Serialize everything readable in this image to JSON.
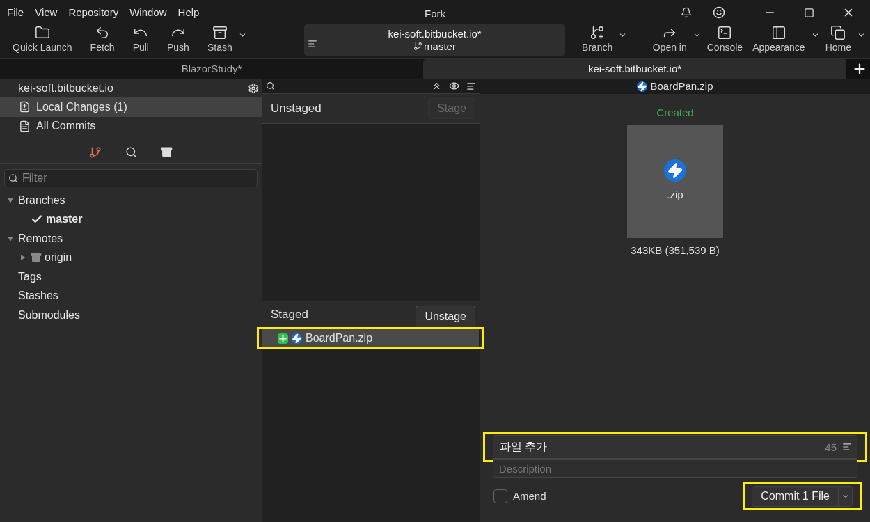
{
  "window": {
    "title": "Fork"
  },
  "menu": [
    {
      "label": "File"
    },
    {
      "label": "View"
    },
    {
      "label": "Repository"
    },
    {
      "label": "Window"
    },
    {
      "label": "Help"
    }
  ],
  "toolbar_left": [
    {
      "label": "Quick Launch",
      "dropdown": false
    },
    {
      "label": "Fetch",
      "dropdown": false
    },
    {
      "label": "Pull",
      "dropdown": false
    },
    {
      "label": "Push",
      "dropdown": false
    },
    {
      "label": "Stash",
      "dropdown": true
    }
  ],
  "repo_box": {
    "repository": "kei-soft.bitbucket.io*",
    "branch": "master"
  },
  "toolbar_branch": {
    "label": "Branch",
    "dropdown": true
  },
  "toolbar_right": [
    {
      "label": "Open in",
      "dropdown": true
    },
    {
      "label": "Console",
      "dropdown": false
    },
    {
      "label": "Appearance",
      "dropdown": true
    },
    {
      "label": "Home",
      "dropdown": true
    }
  ],
  "tabs": [
    {
      "label": "BlazorStudy*",
      "selected": false
    },
    {
      "label": "kei-soft.bitbucket.io*",
      "selected": true
    }
  ],
  "sidebar": {
    "repository": "kei-soft.bitbucket.io",
    "items": [
      {
        "label": "Local Changes (1)",
        "selected": true
      },
      {
        "label": "All Commits",
        "selected": false
      }
    ],
    "filter": {
      "placeholder": "Filter"
    },
    "tree": [
      {
        "label": "Branches",
        "expanded": true,
        "children": [
          {
            "label": "master",
            "current": true
          }
        ]
      },
      {
        "label": "Remotes",
        "expanded": true,
        "children": [
          {
            "label": "origin",
            "expanded": false
          }
        ]
      },
      {
        "label": "Tags"
      },
      {
        "label": "Stashes"
      },
      {
        "label": "Submodules"
      }
    ]
  },
  "unstaged": {
    "title": "Unstaged",
    "button": {
      "label": "Stage",
      "disabled": true
    }
  },
  "staged": {
    "title": "Staged",
    "button": {
      "label": "Unstage",
      "disabled": false
    },
    "files": [
      {
        "name": "BoardPan.zip",
        "selected": true
      }
    ]
  },
  "preview": {
    "file": "BoardPan.zip",
    "status": "Created",
    "extension": ".zip",
    "size": "343KB (351,539 B)"
  },
  "commit": {
    "summary": "파일 추가",
    "counter": "45",
    "description": {
      "placeholder": "Description"
    },
    "amend": {
      "label": "Amend",
      "checked": false
    },
    "button": "Commit 1 File"
  }
}
